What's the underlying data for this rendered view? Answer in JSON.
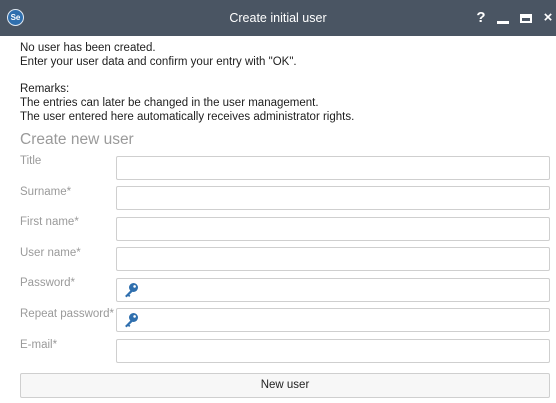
{
  "window": {
    "title": "Create initial user",
    "logo_text": "Se",
    "help_symbol": "?",
    "close_symbol": "×"
  },
  "intro": {
    "line1": "No user has been created.",
    "line2": "Enter your user data and confirm your entry with \"OK\"."
  },
  "remarks": {
    "heading": "Remarks:",
    "line1": "The entries can later be changed in the user management.",
    "line2": "The user entered here automatically receives administrator rights."
  },
  "form": {
    "section_title": "Create new user",
    "fields": {
      "title": {
        "label": "Title",
        "value": ""
      },
      "surname": {
        "label": "Surname*",
        "value": ""
      },
      "first_name": {
        "label": "First name*",
        "value": ""
      },
      "user_name": {
        "label": "User name*",
        "value": ""
      },
      "password": {
        "label": "Password*",
        "value": ""
      },
      "repeat_password": {
        "label": "Repeat password*",
        "value": ""
      },
      "email": {
        "label": "E-mail*",
        "value": ""
      }
    },
    "submit_label": "New user"
  },
  "icons": {
    "password": "key-icon",
    "repeat_password": "key-icon"
  },
  "colors": {
    "titlebar": "#4a5563",
    "key_icon": "#2f6fae",
    "label_gray": "#9a9a9a"
  }
}
